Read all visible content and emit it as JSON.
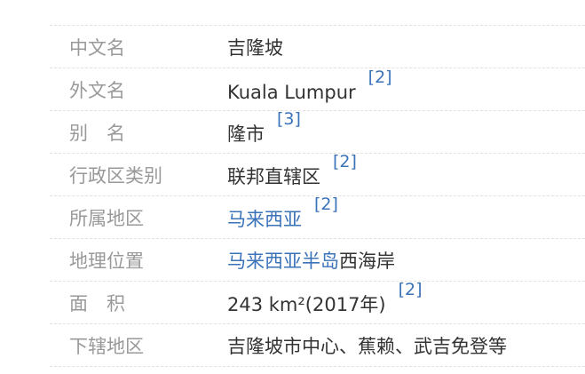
{
  "infobox": {
    "rows": [
      {
        "label": "中文名",
        "value": "吉隆坡"
      },
      {
        "label": "外文名",
        "value": "Kuala Lumpur",
        "ref": "[2]"
      },
      {
        "label": "别　名",
        "value": "隆市",
        "ref": "[3]"
      },
      {
        "label": "行政区类别",
        "value": "联邦直辖区",
        "ref": "[2]"
      },
      {
        "label": "所属地区",
        "link": "马来西亚",
        "ref": "[2]"
      },
      {
        "label": "地理位置",
        "link": "马来西亚半岛",
        "value": "西海岸"
      },
      {
        "label": "面　积",
        "value": "243 km²(2017年)",
        "ref": "[2]"
      },
      {
        "label": "下辖地区",
        "value": "吉隆坡市中心、蕉赖、武吉免登等"
      }
    ]
  },
  "colors": {
    "label": "#999999",
    "value": "#333333",
    "link": "#3b73b9",
    "divider": "#e3e3e3"
  }
}
